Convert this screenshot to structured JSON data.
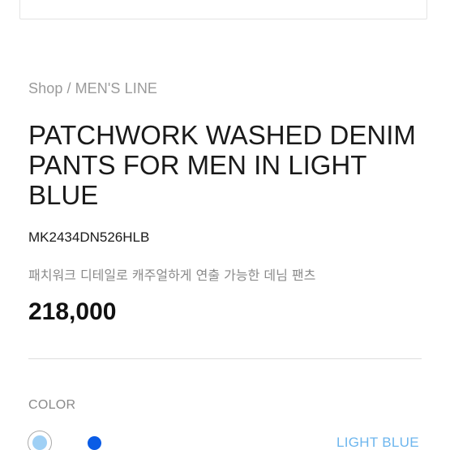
{
  "breadcrumb": {
    "shop": "Shop",
    "separator": "/",
    "category": "MEN'S LINE"
  },
  "product": {
    "title": "PATCHWORK WASHED DENIM PANTS FOR MEN IN LIGHT BLUE",
    "sku": "MK2434DN526HLB",
    "description": "패치워크 디테일로 캐주얼하게 연출 가능한 데님 팬츠",
    "price": "218,000"
  },
  "color": {
    "label": "COLOR",
    "selected_name": "LIGHT BLUE",
    "swatches": [
      {
        "color": "#9fd0f5",
        "selected": true
      },
      {
        "color": "#0a5ce6",
        "selected": false
      }
    ]
  },
  "colors": {
    "accent_light_blue": "#6db6ee",
    "text_muted": "#8a8a8a",
    "divider": "#dddddd"
  }
}
